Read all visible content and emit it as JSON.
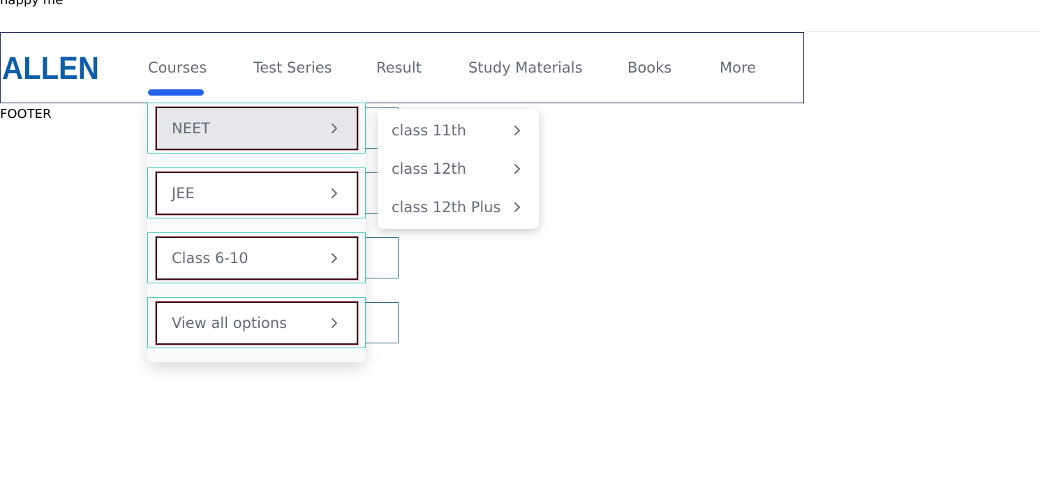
{
  "page": {
    "top_text": "happy me",
    "footer_text": "FOOTER"
  },
  "navbar": {
    "logo_text": "ALLEN",
    "items": [
      {
        "label": "Courses"
      },
      {
        "label": "Test Series"
      },
      {
        "label": "Result"
      },
      {
        "label": "Study Materials"
      },
      {
        "label": "Books"
      },
      {
        "label": "More"
      }
    ],
    "active_item": "Courses",
    "accent_color": "#2563eb",
    "logo_color": "#0d5ea8"
  },
  "courses_menu": {
    "items": [
      {
        "label": "NEET",
        "icon": "chevron-right-icon"
      },
      {
        "label": "JEE",
        "icon": "chevron-right-icon"
      },
      {
        "label": "Class 6-10",
        "icon": "chevron-right-icon"
      },
      {
        "label": "View all options",
        "icon": "chevron-right-icon"
      }
    ],
    "highlighted_item": "NEET"
  },
  "neet_submenu": {
    "items": [
      {
        "label": "class 11th",
        "icon": "chevron-right-icon"
      },
      {
        "label": "class 12th",
        "icon": "chevron-right-icon"
      },
      {
        "label": "class 12th Plus",
        "icon": "chevron-right-icon"
      }
    ]
  }
}
